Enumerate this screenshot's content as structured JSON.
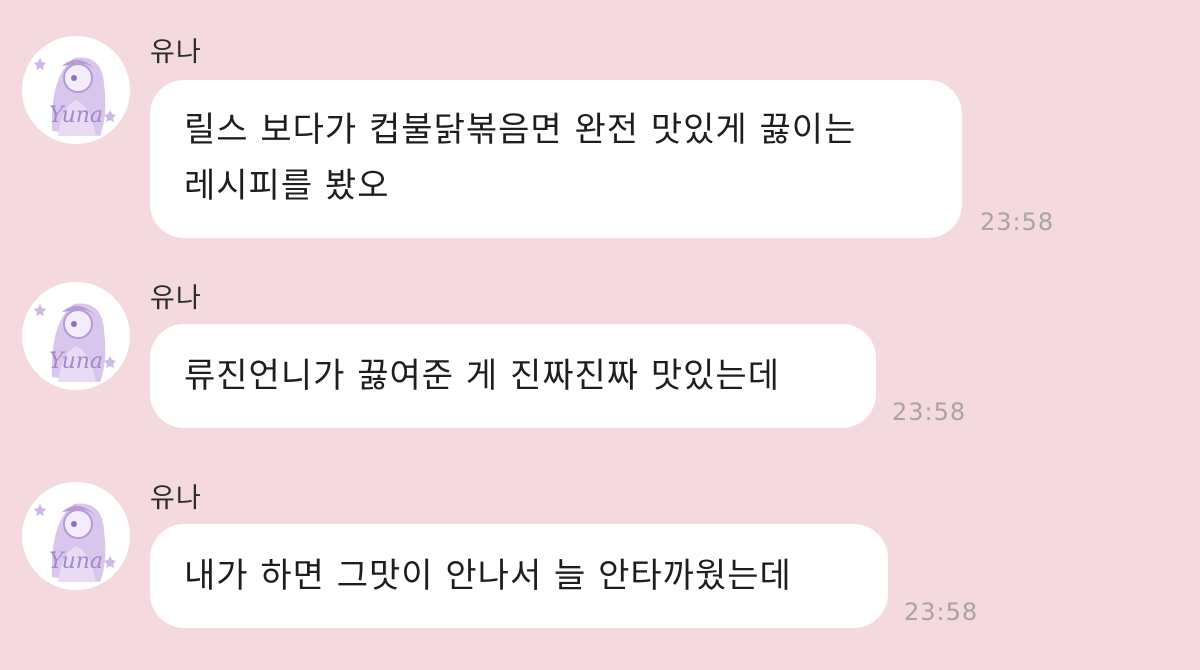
{
  "messages": [
    {
      "sender": "유나",
      "avatar_icon": "yuna-avatar-icon",
      "avatar_text": "Yuna",
      "lines": [
        "릴스 보다가 컵불닭볶음면 완전 맛있게 끓이는",
        "레시피를 봤오"
      ],
      "time": "23:58"
    },
    {
      "sender": "유나",
      "avatar_icon": "yuna-avatar-icon",
      "avatar_text": "Yuna",
      "lines": [
        "류진언니가 끓여준 게 진짜진짜 맛있는데"
      ],
      "time": "23:58"
    },
    {
      "sender": "유나",
      "avatar_icon": "yuna-avatar-icon",
      "avatar_text": "Yuna",
      "lines": [
        "내가 하면 그맛이 안나서 늘 안타까웠는데"
      ],
      "time": "23:58"
    }
  ],
  "colors": {
    "background": "#f4d9de",
    "bubble": "#ffffff",
    "time": "#a9a3a6",
    "avatar_accent": "#b79ad6"
  }
}
